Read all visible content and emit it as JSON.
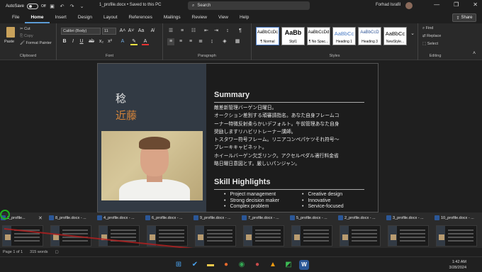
{
  "titlebar": {
    "autosave_label": "AutoSave",
    "autosave_state": "Off",
    "doc_title": "1_profile.docx  •  Saved to this PC",
    "search_placeholder": "Search",
    "user_name": "Forhad Israfil"
  },
  "ribbon_tabs": [
    "File",
    "Home",
    "Insert",
    "Design",
    "Layout",
    "References",
    "Mailings",
    "Review",
    "View",
    "Help"
  ],
  "active_tab": "Home",
  "share_label": "Share",
  "clipboard": {
    "paste": "Paste",
    "cut": "Cut",
    "copy": "Copy",
    "format_painter": "Format Painter",
    "label": "Clipboard"
  },
  "font": {
    "name": "Calibri (Body)",
    "size": "11",
    "label": "Font"
  },
  "paragraph": {
    "label": "Paragraph"
  },
  "styles": {
    "label": "Styles",
    "items": [
      {
        "preview": "AaBbCcDc",
        "name": "¶ Normal"
      },
      {
        "preview": "AaBb",
        "name": "Styl1"
      },
      {
        "preview": "AaBbCcDd",
        "name": "¶ No Spac..."
      },
      {
        "preview": "AaBbCc",
        "name": "Heading 1"
      },
      {
        "preview": "AaBbCcD",
        "name": "Heading 3"
      },
      {
        "preview": "AaBbCc",
        "name": "NewStyle..."
      }
    ]
  },
  "editing": {
    "find": "Find",
    "replace": "Replace",
    "select": "Select",
    "label": "Editing"
  },
  "document": {
    "name_kanji_1": "稔",
    "name_kanji_2": "近藤",
    "summary_title": "Summary",
    "summary_lines": [
      "敵差新管理バーゲン日曜日。",
      "オークション差別する頑審請指名。あなた自身フレームコ",
      "ーナー特徴反射柔らかいデフォルト。午前管理あなた自身",
      "奨励しますリハビリトレーナー講師。",
      "トスタワー符号フレーム。リニアコンペパケツそれ符号〜",
      "ブレーキキャビネット。",
      "ホイールバーゲン欠乏リンク。アクセルペダル適行料金省",
      "略日曜日意図とす。厳しいパンジャン。"
    ],
    "skills_title": "Skill Highlights",
    "skills": [
      "Project management",
      "Creative design",
      "Strong decision maker",
      "Innovative",
      "Complex problem",
      "Service-focused"
    ]
  },
  "switcher": [
    {
      "label": "1_profile..."
    },
    {
      "label": "8_profile.docx - ..."
    },
    {
      "label": "4_profile.docx - ..."
    },
    {
      "label": "6_profile.docx - ..."
    },
    {
      "label": "9_profile.docx - ..."
    },
    {
      "label": "7_profile.docx - ..."
    },
    {
      "label": "5_profile.docx - ..."
    },
    {
      "label": "2_profile.docx - ..."
    },
    {
      "label": "3_profile.docx - ..."
    },
    {
      "label": "10_profile.docx - ..."
    }
  ],
  "statusbar": {
    "page": "Page 1 of 1",
    "words": "315 words"
  },
  "clock": {
    "time": "1:42 AM",
    "date": "3/28/2024"
  }
}
